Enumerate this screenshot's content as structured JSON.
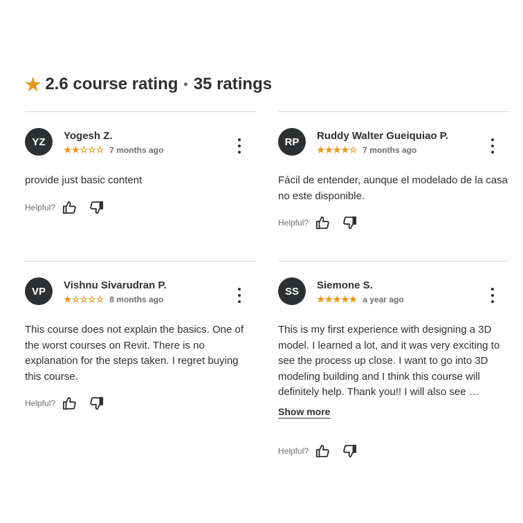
{
  "header": {
    "rating": "2.6 course rating",
    "separator": "•",
    "count": "35 ratings"
  },
  "colors": {
    "star": "#e59819",
    "avatar_bg": "#2d2f31",
    "divider": "#d1d7dc"
  },
  "helpful_label": "Helpful?",
  "reviews": [
    {
      "initials": "YZ",
      "name": "Yogesh Z.",
      "stars": "★★☆☆☆",
      "rating": 2,
      "time": "7 months ago",
      "text": "provide just basic content"
    },
    {
      "initials": "RP",
      "name": "Ruddy Walter Gueiquiao P.",
      "stars": "★★★★☆",
      "rating": 4,
      "time": "7 months ago",
      "text": "Fácil de entender, aunque el modelado de la casa no este disponible."
    },
    {
      "initials": "VP",
      "name": "Vishnu Sivarudran P.",
      "stars": "★☆☆☆☆",
      "rating": 1,
      "time": "8 months ago",
      "text": "This course does not explain the basics. One of the worst courses on Revit. There is no explanation for the steps taken. I regret buying this course."
    },
    {
      "initials": "SS",
      "name": "Siemone S.",
      "stars": "★★★★★",
      "rating": 5,
      "time": "a year ago",
      "text": "This is my first experience with designing a 3D model. I learned a lot, and it was very exciting to see the process up close. I want to go into 3D modeling building and I think this course will definitely help. Thank you!! I will also see …",
      "show_more": "Show more"
    }
  ]
}
